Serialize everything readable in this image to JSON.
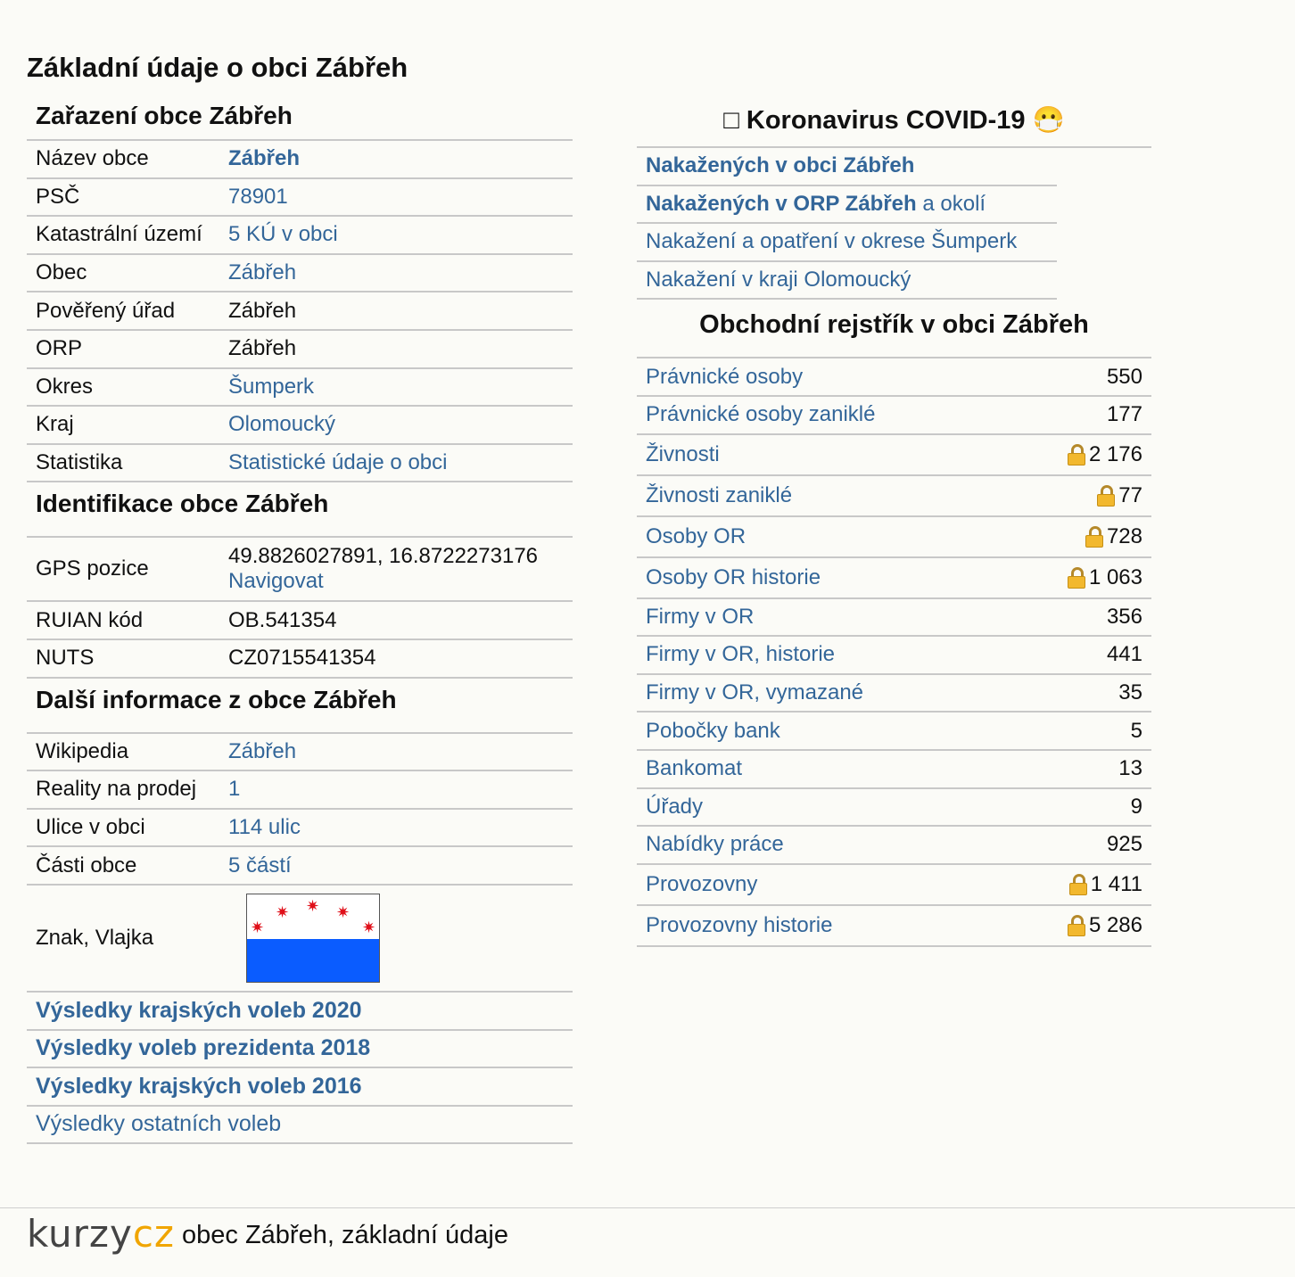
{
  "page_title": "Základní údaje o obci Zábřeh",
  "zarazeni": {
    "heading": "Zařazení obce Zábřeh",
    "rows": [
      {
        "key": "Název obce",
        "value": "Zábřeh",
        "link": true,
        "bold": true
      },
      {
        "key": "PSČ",
        "value": "78901",
        "link": true
      },
      {
        "key": "Katastrální území",
        "value": "5 KÚ v obci",
        "link": true
      },
      {
        "key": "Obec",
        "value": "Zábřeh",
        "link": true
      },
      {
        "key": "Pověřený úřad",
        "value": "Zábřeh",
        "link": false
      },
      {
        "key": "ORP",
        "value": "Zábřeh",
        "link": false
      },
      {
        "key": "Okres",
        "value": "Šumperk",
        "link": true
      },
      {
        "key": "Kraj",
        "value": "Olomoucký",
        "link": true
      },
      {
        "key": "Statistika",
        "value": "Statistické údaje o obci",
        "link": true
      }
    ]
  },
  "identifikace": {
    "heading": "Identifikace obce Zábřeh",
    "gps_label": "GPS pozice",
    "gps_value": "49.8826027891, 16.8722273176",
    "gps_nav": "Navigovat",
    "rows": [
      {
        "key": "RUIAN kód",
        "value": "OB.541354"
      },
      {
        "key": "NUTS",
        "value": "CZ0715541354"
      }
    ]
  },
  "dalsi": {
    "heading": "Další informace z obce Zábřeh",
    "rows": [
      {
        "key": "Wikipedia",
        "value": "Zábřeh"
      },
      {
        "key": "Reality na prodej",
        "value": "1"
      },
      {
        "key": "Ulice v obci",
        "value": "114 ulic"
      },
      {
        "key": "Části obce",
        "value": "5 částí"
      }
    ],
    "znak_label": "Znak, Vlajka"
  },
  "votes": [
    {
      "label": "Výsledky krajských voleb 2020",
      "bold": true
    },
    {
      "label": "Výsledky voleb prezidenta 2018",
      "bold": true
    },
    {
      "label": "Výsledky krajských voleb 2016",
      "bold": true
    },
    {
      "label": "Výsledky ostatních voleb",
      "bold": false
    }
  ],
  "covid": {
    "heading_icon": "□",
    "heading": "Koronavirus COVID-19",
    "heading_emoji": "😷",
    "links": [
      {
        "bold": "Nakažených v obci Zábřeh",
        "rest": ""
      },
      {
        "bold": "Nakažených v ORP Zábřeh",
        "rest": " a okolí"
      },
      {
        "bold": "",
        "rest": "Nakažení a opatření v okrese Šumperk"
      },
      {
        "bold": "",
        "rest": "Nakažení v kraji Olomoucký"
      }
    ]
  },
  "rejstrik": {
    "heading": "Obchodní rejstřík v obci Zábřeh",
    "rows": [
      {
        "label": "Právnické osoby",
        "value": "550",
        "lock": false
      },
      {
        "label": "Právnické osoby zaniklé",
        "value": "177",
        "lock": false
      },
      {
        "label": "Živnosti",
        "value": "2 176",
        "lock": true
      },
      {
        "label": "Živnosti zaniklé",
        "value": "77",
        "lock": true
      },
      {
        "label": "Osoby OR",
        "value": "728",
        "lock": true
      },
      {
        "label": "Osoby OR historie",
        "value": "1 063",
        "lock": true
      },
      {
        "label": "Firmy v OR",
        "value": "356",
        "lock": false
      },
      {
        "label": "Firmy v OR, historie",
        "value": "441",
        "lock": false
      },
      {
        "label": "Firmy v OR, vymazané",
        "value": "35",
        "lock": false
      },
      {
        "label": "Pobočky bank",
        "value": "5",
        "lock": false
      },
      {
        "label": "Bankomat",
        "value": "13",
        "lock": false
      },
      {
        "label": "Úřady",
        "value": "9",
        "lock": false
      },
      {
        "label": "Nabídky práce",
        "value": "925",
        "lock": false
      },
      {
        "label": "Provozovny",
        "value": "1 411",
        "lock": true
      },
      {
        "label": "Provozovny historie",
        "value": "5 286",
        "lock": true
      }
    ]
  },
  "footer": {
    "logo_part1": "kurzy",
    "logo_part2": "cz",
    "text": "obec Zábřeh, základní údaje"
  },
  "colors": {
    "link": "#336699",
    "flag_blue": "#0a5cff",
    "flag_star": "#e0101a",
    "logo_accent": "#f0a500"
  }
}
